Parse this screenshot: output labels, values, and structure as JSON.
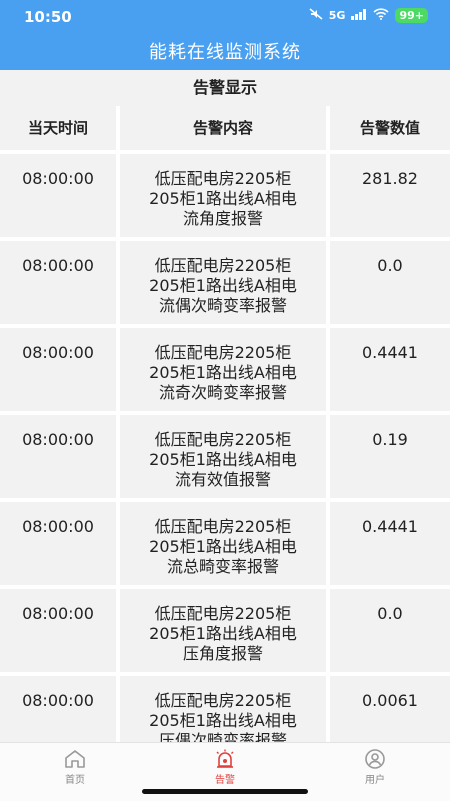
{
  "status_bar": {
    "time": "10:50",
    "network": "5G",
    "battery": "99+"
  },
  "header": {
    "title": "能耗在线监测系统"
  },
  "section": {
    "title": "告警显示"
  },
  "table": {
    "columns": [
      "当天时间",
      "告警内容",
      "告警数值"
    ],
    "rows": [
      {
        "time": "08:00:00",
        "content": [
          "低压配电房2205柜",
          "205柜1路出线A相电",
          "流角度报警"
        ],
        "value": "281.82"
      },
      {
        "time": "08:00:00",
        "content": [
          "低压配电房2205柜",
          "205柜1路出线A相电",
          "流偶次畸变率报警"
        ],
        "value": "0.0"
      },
      {
        "time": "08:00:00",
        "content": [
          "低压配电房2205柜",
          "205柜1路出线A相电",
          "流奇次畸变率报警"
        ],
        "value": "0.4441"
      },
      {
        "time": "08:00:00",
        "content": [
          "低压配电房2205柜",
          "205柜1路出线A相电",
          "流有效值报警"
        ],
        "value": "0.19"
      },
      {
        "time": "08:00:00",
        "content": [
          "低压配电房2205柜",
          "205柜1路出线A相电",
          "流总畸变率报警"
        ],
        "value": "0.4441"
      },
      {
        "time": "08:00:00",
        "content": [
          "低压配电房2205柜",
          "205柜1路出线A相电",
          "压角度报警"
        ],
        "value": "0.0"
      },
      {
        "time": "08:00:00",
        "content": [
          "低压配电房2205柜",
          "205柜1路出线A相电",
          "压偶次畸变率报警"
        ],
        "value": "0.0061"
      }
    ]
  },
  "tabbar": {
    "items": [
      {
        "label": "首页",
        "icon": "home-icon",
        "active": false
      },
      {
        "label": "告警",
        "icon": "alarm-icon",
        "active": true
      },
      {
        "label": "用户",
        "icon": "user-icon",
        "active": false
      }
    ],
    "active_color": "#e0403c",
    "inactive_color": "#888888"
  },
  "colors": {
    "header_bg": "#4aa0f0",
    "cell_bg": "#f2f2f2"
  }
}
